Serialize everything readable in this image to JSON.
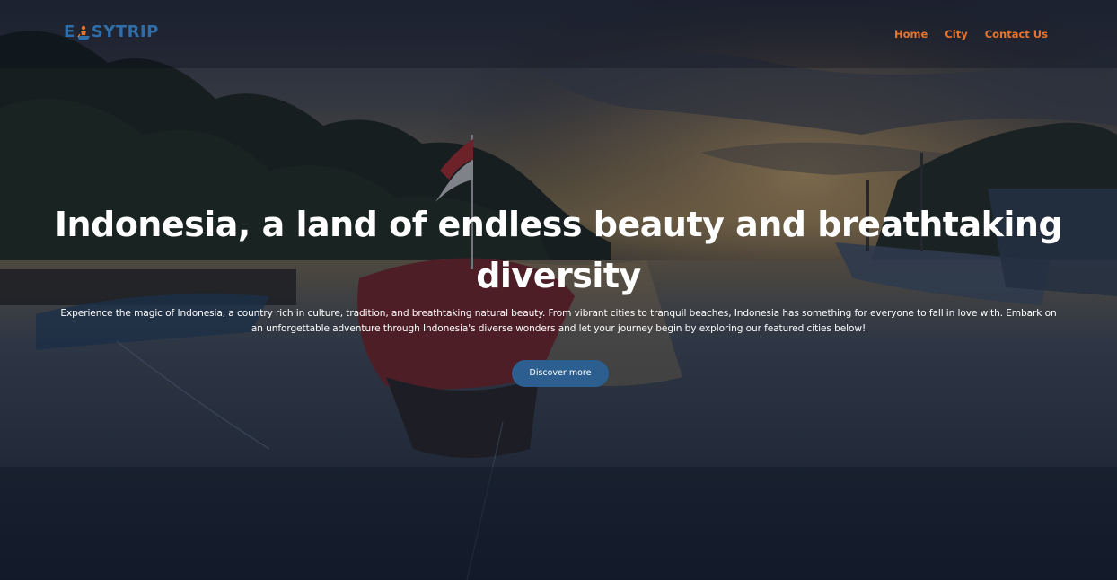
{
  "navbar": {
    "logo": {
      "text_before": "E",
      "text_after": "SYTRIP",
      "icon": "boat-traveler-icon",
      "color": "#2f6ea8"
    },
    "links": [
      {
        "label": "Home"
      },
      {
        "label": "City"
      },
      {
        "label": "Contact Us"
      }
    ],
    "link_color": "#e8742c"
  },
  "hero": {
    "headline": "Indonesia, a land of endless beauty and breathtaking diversity",
    "description": "Experience the magic of Indonesia, a country rich in culture, tradition, and breathtaking natural beauty. From vibrant cities to tranquil beaches, Indonesia has something for everyone to fall in love with. Embark on an unforgettable adventure through Indonesia's diverse wonders and let your journey begin by exploring our featured cities below!",
    "button_label": "Discover more",
    "button_color": "#2c5f8f",
    "background": "harbor-sunset-photo"
  }
}
